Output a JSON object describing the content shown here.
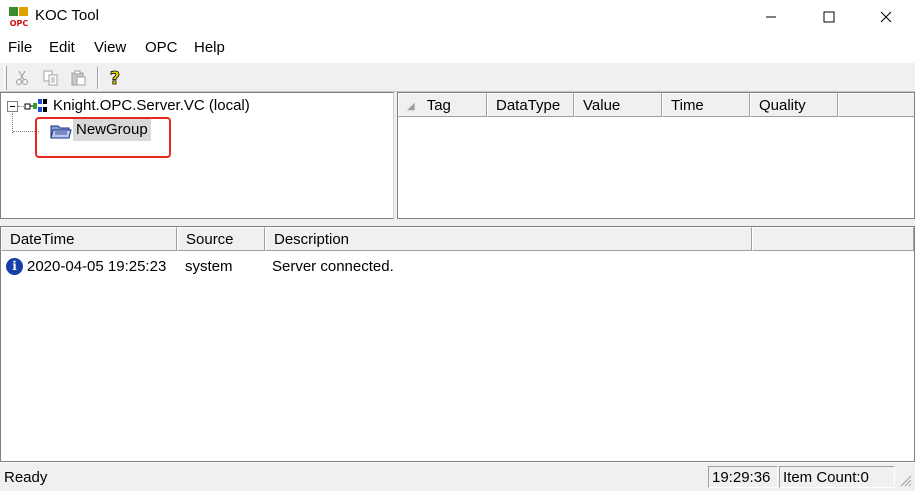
{
  "window": {
    "title": "KOC Tool",
    "logo_text": "OPC"
  },
  "menu": [
    "File",
    "Edit",
    "View",
    "OPC",
    "Help"
  ],
  "toolbar": {
    "buttons": [
      "cut-icon",
      "copy-icon",
      "paste-icon",
      "help-icon"
    ],
    "help_glyph": "?"
  },
  "tree": {
    "server": {
      "label": "Knight.OPC.Server.VC (local)",
      "expanded": true
    },
    "group": {
      "label": "NewGroup",
      "selected": true,
      "highlight_color": "#e8281e"
    }
  },
  "tag_list": {
    "columns": [
      "Tag",
      "DataType",
      "Value",
      "Time",
      "Quality"
    ],
    "rows": []
  },
  "log": {
    "columns": [
      "DateTime",
      "Source",
      "Description"
    ],
    "rows": [
      {
        "icon": "info-icon",
        "icon_glyph": "i",
        "datetime": "2020-04-05 19:25:23",
        "source": "system",
        "description": "Server connected."
      }
    ]
  },
  "status": {
    "text": "Ready",
    "clock": "19:29:36",
    "item_count": "Item Count:0"
  }
}
